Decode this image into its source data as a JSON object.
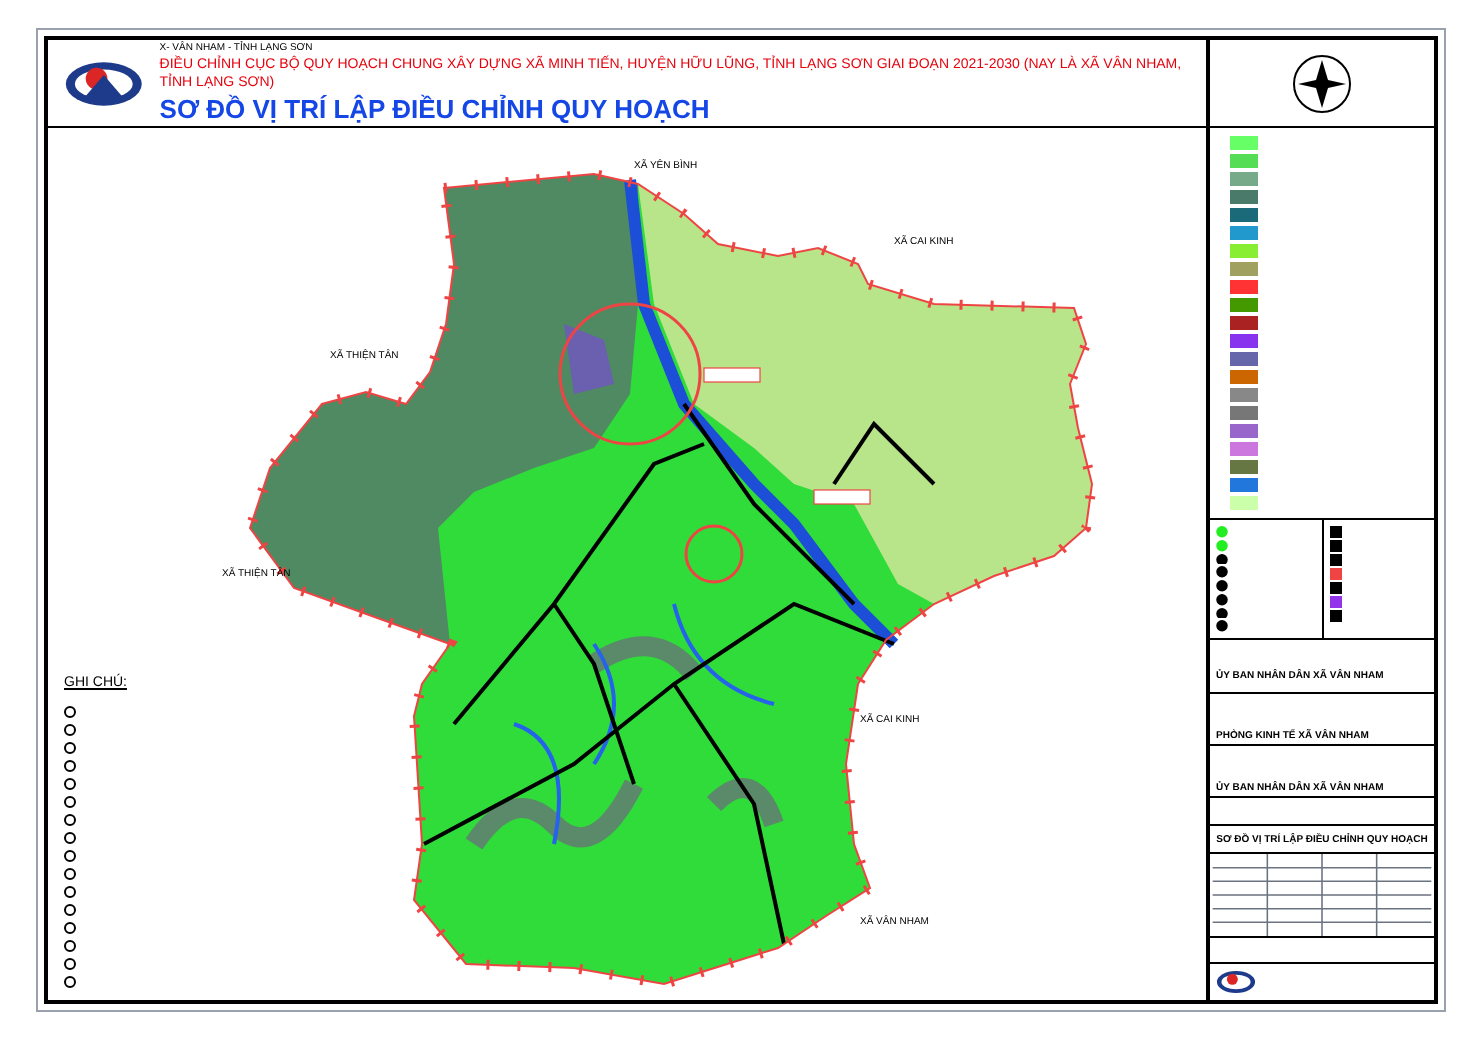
{
  "header": {
    "commune": "X- VÂN NHAM - TỈNH LẠNG SƠN",
    "project": "ĐIỀU CHỈNH CỤC BỘ QUY HOẠCH CHUNG XÂY DỰNG XÃ MINH TIẾN, HUYỆN HỮU LŨNG, TỈNH LẠNG SƠN GIAI ĐOẠN 2021-2030 (NAY LÀ XÃ VÂN NHAM, TỈNH LẠNG SƠN)",
    "title": "SƠ ĐỒ VỊ TRÍ LẬP ĐIỀU CHỈNH QUY HOẠCH"
  },
  "map": {
    "labels": [
      "XÃ YÊN BÌNH",
      "XÃ CAI KINH",
      "XÃ THIỆN TÂN",
      "XÃ THIỆN TÂN",
      "XÃ CAI KINH",
      "XÃ VÂN NHAM"
    ]
  },
  "notes": {
    "title": "GHI CHÚ:"
  },
  "legend": {
    "swatches": [
      {
        "color": "#66ff66"
      },
      {
        "color": "#55dd55"
      },
      {
        "color": "#77aa88"
      },
      {
        "color": "#4a7a6a"
      },
      {
        "color": "#1a6a7a"
      },
      {
        "color": "#2299cc"
      },
      {
        "color": "#88ee33"
      },
      {
        "color": "#a0a060"
      },
      {
        "color": "#ff3333"
      },
      {
        "color": "#449900"
      },
      {
        "color": "#aa2222"
      },
      {
        "color": "#8833ee"
      },
      {
        "color": "#6666aa"
      },
      {
        "color": "#cc6600"
      },
      {
        "color": "#888888"
      },
      {
        "color": "#777777"
      },
      {
        "color": "#9966cc"
      },
      {
        "color": "#cc77dd"
      },
      {
        "color": "#667744"
      },
      {
        "color": "#2277dd"
      },
      {
        "color": "#ccffaa"
      }
    ]
  },
  "title_block": {
    "authority": "ỦY BAN NHÂN DÂN XÃ VÂN NHAM",
    "agency": "PHÒNG KINH TẾ XÃ VÂN NHAM",
    "approver": "ỦY BAN NHÂN DÂN XÃ VÂN NHAM",
    "drawing_title": "SƠ ĐỒ VỊ TRÍ LẬP ĐIỀU CHỈNH QUY HOẠCH"
  }
}
